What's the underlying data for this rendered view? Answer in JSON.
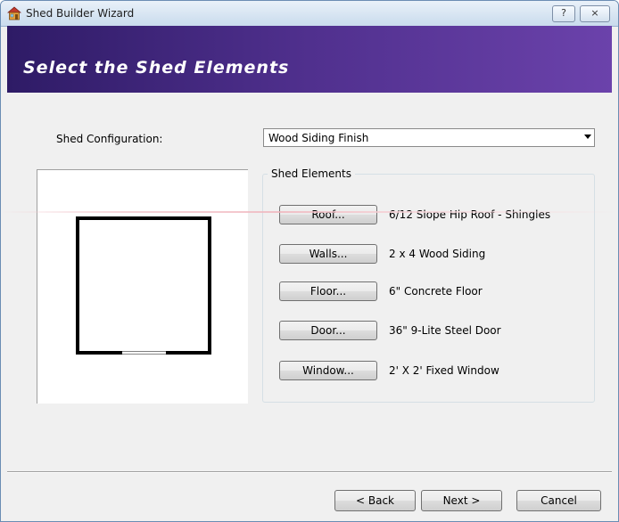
{
  "window": {
    "title": "Shed Builder Wizard",
    "help_label": "?",
    "close_label": "×"
  },
  "banner": {
    "title": "Select the Shed Elements"
  },
  "config": {
    "label": "Shed Configuration:",
    "selected": "Wood Siding Finish"
  },
  "elements": {
    "group_title": "Shed Elements",
    "items": [
      {
        "button": "Roof...",
        "value": "6/12 Slope Hip Roof - Shingles"
      },
      {
        "button": "Walls...",
        "value": "2 x 4 Wood Siding"
      },
      {
        "button": "Floor...",
        "value": "6\" Concrete Floor"
      },
      {
        "button": "Door...",
        "value": "36\" 9-Lite Steel Door"
      },
      {
        "button": "Window...",
        "value": "2' X 2' Fixed Window"
      }
    ]
  },
  "footer": {
    "back_label": "< Back",
    "next_label": "Next >",
    "cancel_label": "Cancel"
  },
  "colors": {
    "banner_start": "#2e1b66",
    "banner_end": "#6b42ab"
  }
}
